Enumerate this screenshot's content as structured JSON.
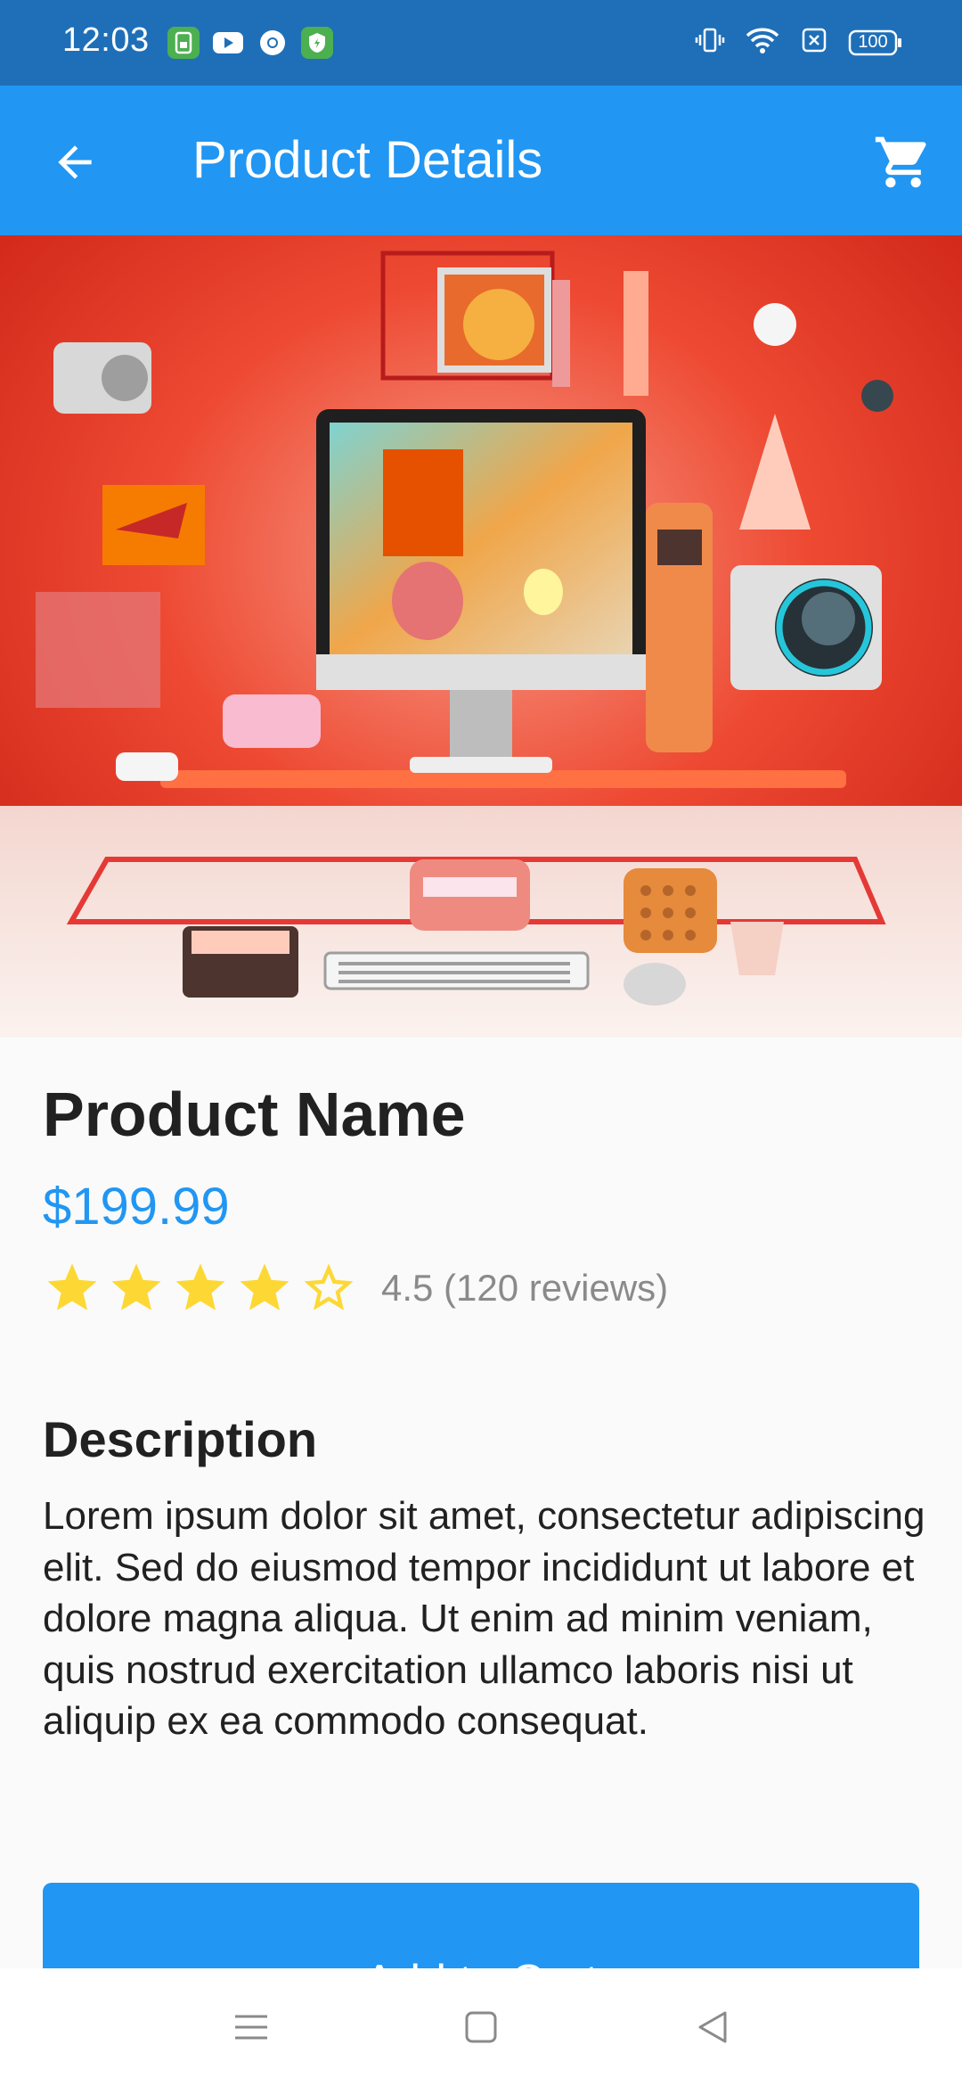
{
  "status_bar": {
    "time": "12:03",
    "battery": "100",
    "app_icons": [
      "sim-icon",
      "youtube-icon",
      "chrome-icon",
      "shield-icon"
    ],
    "system_icons": [
      "vibrate-icon",
      "wifi-icon",
      "sim-off-icon",
      "battery-icon"
    ]
  },
  "app_bar": {
    "title": "Product Details",
    "back_icon": "arrow-back-icon",
    "cart_icon": "shopping-cart-icon"
  },
  "product": {
    "name": "Product Name",
    "price": "$199.99",
    "rating_value": 4.5,
    "rating_text": "4.5 (120 reviews)",
    "stars": [
      "full",
      "full",
      "full",
      "full",
      "empty"
    ]
  },
  "description": {
    "title": "Description",
    "body": "Lorem ipsum dolor sit amet, consectetur adipiscing elit. Sed do eiusmod tempor incididunt ut labore et dolore magna aliqua. Ut enim ad minim veniam, quis nostrud exercitation ullamco laboris nisi ut aliquip ex ea commodo consequat."
  },
  "actions": {
    "add_to_cart": "Add to Cart"
  },
  "nav_bar": {
    "buttons": [
      "menu-icon",
      "home-icon",
      "back-triangle-icon"
    ]
  },
  "colors": {
    "status_bar": "#1e6fb8",
    "primary": "#2196f3",
    "star": "#fdd835",
    "background": "#fafafa"
  }
}
